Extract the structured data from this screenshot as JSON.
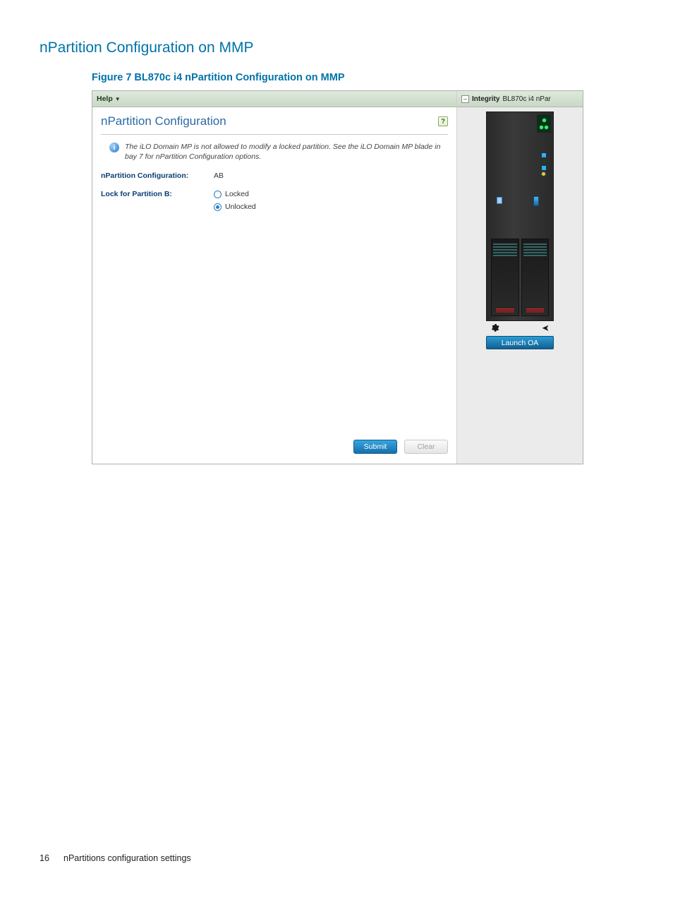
{
  "doc": {
    "heading": "nPartition Configuration on MMP",
    "figure_caption": "Figure 7  BL870c i4 nPartition Configuration on MMP"
  },
  "menubar": {
    "help_label": "Help"
  },
  "main": {
    "title": "nPartition Configuration",
    "info_text": "The iLO Domain MP is not allowed to modify a locked partition. See the iLO Domain MP blade in bay 7 for nPartition Configuration options.",
    "config_label": "nPartition Configuration:",
    "config_value": "AB",
    "lock_label": "Lock for Partition B:",
    "radio_locked": "Locked",
    "radio_unlocked": "Unlocked",
    "submit_label": "Submit",
    "clear_label": "Clear"
  },
  "right": {
    "prefix": "Integrity",
    "model": "BL870c i4 nPar",
    "launch_label": "Launch OA"
  },
  "footer": {
    "page_number": "16",
    "section_title": "nPartitions configuration settings"
  }
}
